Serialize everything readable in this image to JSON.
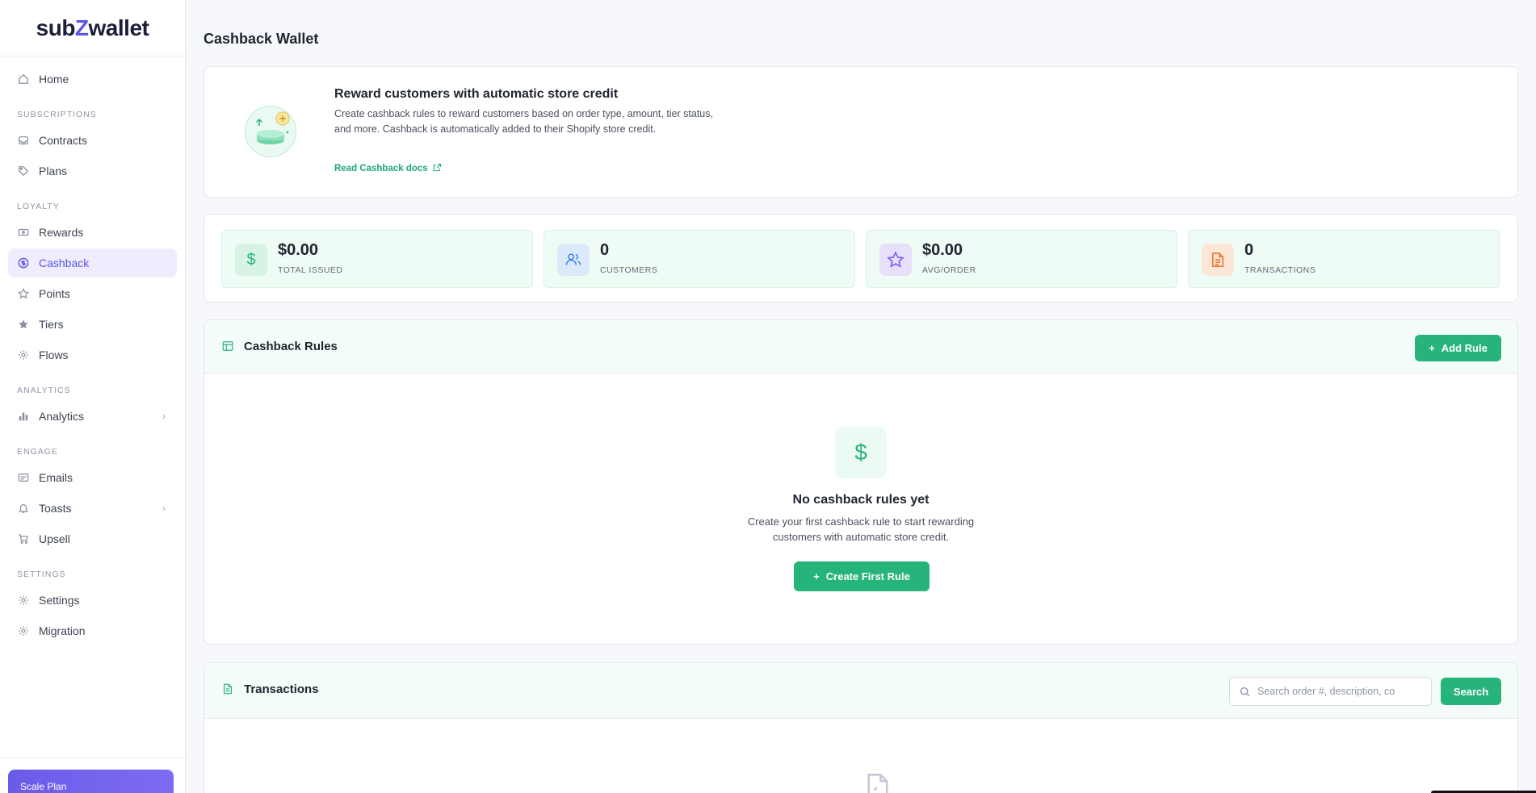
{
  "sidebar": {
    "logo": {
      "part1": "sub",
      "part2": "Z",
      "part3": "wallet"
    },
    "home": "Home",
    "sections": {
      "subscriptions": "SUBSCRIPTIONS",
      "loyalty": "LOYALTY",
      "analytics": "ANALYTICS",
      "engage": "ENGAGE",
      "settings": "SETTINGS"
    },
    "items": {
      "contracts": "Contracts",
      "plans": "Plans",
      "rewards": "Rewards",
      "cashback": "Cashback",
      "points": "Points",
      "tiers": "Tiers",
      "flows": "Flows",
      "analytics": "Analytics",
      "emails": "Emails",
      "toasts": "Toasts",
      "upsell": "Upsell",
      "settings": "Settings",
      "migration": "Migration"
    },
    "active": "cashback",
    "plan_label": "Scale Plan"
  },
  "page": {
    "title": "Cashback Wallet"
  },
  "intro": {
    "title": "Reward customers with automatic store credit",
    "description": "Create cashback rules to reward customers based on order type, amount, tier status, and more. Cashback is automatically added to their Shopify store credit.",
    "link": "Read Cashback docs"
  },
  "stats": [
    {
      "value": "$0.00",
      "label": "TOTAL ISSUED",
      "icon": "dollar-icon",
      "color": "#27b47b",
      "bg": "#d6f3e5"
    },
    {
      "value": "0",
      "label": "CUSTOMERS",
      "icon": "users-icon",
      "color": "#3b82f6",
      "bg": "#dce9fb"
    },
    {
      "value": "$0.00",
      "label": "AVG/ORDER",
      "icon": "star-icon",
      "color": "#7c5ce8",
      "bg": "#e6e0fb"
    },
    {
      "value": "0",
      "label": "TRANSACTIONS",
      "icon": "document-icon",
      "color": "#ea7a2a",
      "bg": "#fbe6d7"
    }
  ],
  "rules": {
    "title": "Cashback Rules",
    "add_button": "Add Rule",
    "empty_title": "No cashback rules yet",
    "empty_desc": "Create your first cashback rule to start rewarding customers with automatic store credit.",
    "create_button": "Create First Rule"
  },
  "transactions": {
    "title": "Transactions",
    "search_placeholder": "Search order #, description, co",
    "search_value": "",
    "search_button": "Search"
  }
}
